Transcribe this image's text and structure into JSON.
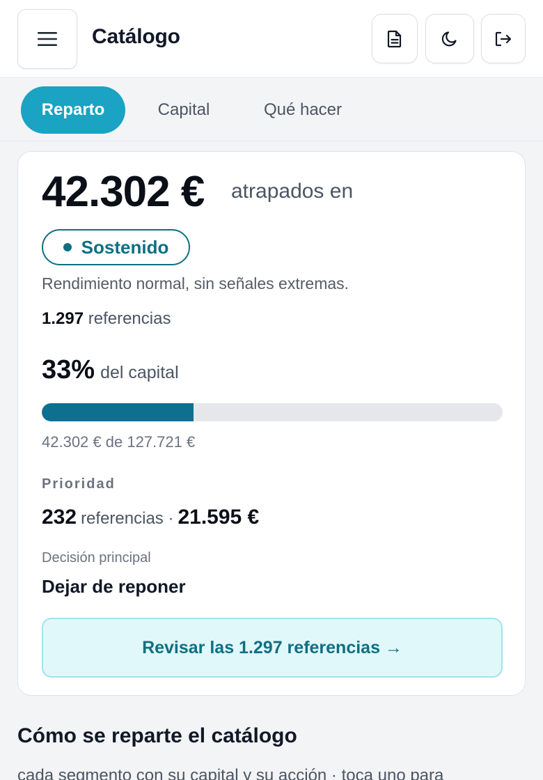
{
  "header": {
    "title": "Catálogo",
    "menu_icon": "hamburger-menu-icon",
    "actions": [
      {
        "icon": "document-icon"
      },
      {
        "icon": "moon-icon"
      },
      {
        "icon": "logout-icon"
      }
    ]
  },
  "tabs": [
    {
      "label": "Reparto",
      "active": true
    },
    {
      "label": "Capital",
      "active": false
    },
    {
      "label": "Qué hacer",
      "active": false
    }
  ],
  "summary": {
    "amount": "42.302 €",
    "amount_suffix": "atrapados en",
    "status_badge": "Sostenido",
    "status_description": "Rendimiento normal, sin señales extremas.",
    "references_count": "1.297",
    "references_label": "referencias",
    "capital_percent": "33%",
    "capital_percent_label": "del capital",
    "capital_fraction": 0.33,
    "capital_detail": "42.302 € de 127.721 €",
    "priority_label": "Prioridad",
    "priority_count": "232",
    "priority_text": "referencias ·",
    "priority_amount": "21.595 €",
    "decision_label": "Decisión principal",
    "decision_value": "Dejar de reponer",
    "review_button": "Revisar las 1.297 referencias →"
  },
  "section": {
    "title": "Cómo se reparte el catálogo",
    "subtitle": "cada segmento con su capital y su acción · toca uno para"
  },
  "colors": {
    "accent": "#1aa3c2",
    "teal_dark": "#0e6f82",
    "progress_fill": "#0e6f8f",
    "button_bg": "#e0f8fa"
  }
}
